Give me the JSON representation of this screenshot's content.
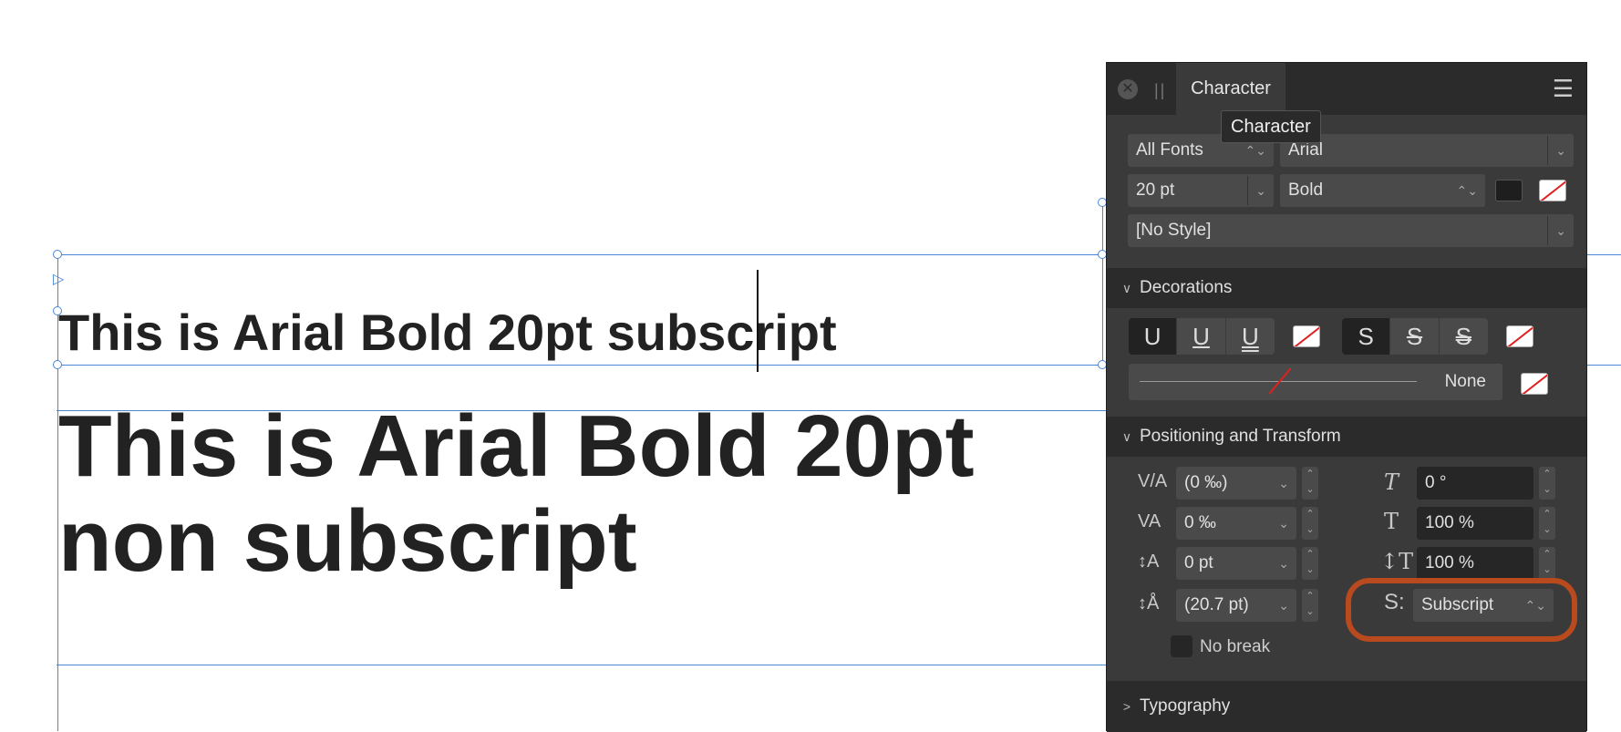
{
  "document": {
    "line1": "This is Arial Bold 20pt subscript",
    "line2a": "This is Arial Bold 20pt",
    "line2b": "non subscript"
  },
  "panel": {
    "tab_label": "Character",
    "tooltip": "Character",
    "font_collection": "All Fonts",
    "font_family": "Arial",
    "font_size": "20 pt",
    "font_style": "Bold",
    "paragraph_style": "[No Style]",
    "sections": {
      "decorations": "Decorations",
      "positioning": "Positioning and Transform",
      "typography": "Typography"
    },
    "decorations": {
      "underline_glyph": "U",
      "strike_glyph": "S",
      "line_style": "None"
    },
    "positioning": {
      "kerning": "(0 ‰)",
      "tracking": "0 ‰",
      "baseline": "0 pt",
      "leading": "(20.7 pt)",
      "skew": "0 °",
      "horizontal_scale": "100 %",
      "vertical_scale": "100 %",
      "script": "Subscript",
      "no_break": "No break"
    }
  },
  "colors": {
    "guide": "#4a86d6",
    "panel_bg": "#3a3a3a",
    "highlight": "#b84a1e"
  }
}
